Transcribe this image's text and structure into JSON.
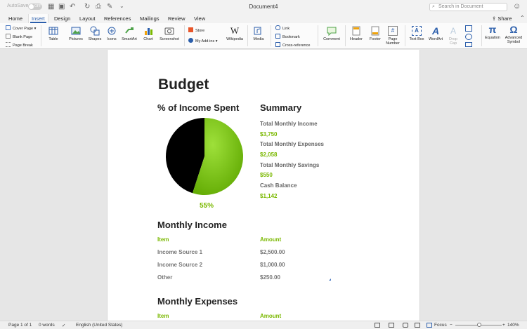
{
  "titlebar": {
    "autosave": "AutoSave",
    "autosave_state": "OFF",
    "document": "Document4",
    "search_placeholder": "Search in Document"
  },
  "tabs": [
    "Home",
    "Insert",
    "Design",
    "Layout",
    "References",
    "Mailings",
    "Review",
    "View"
  ],
  "active_tab": "Insert",
  "share": "Share",
  "ribbon": {
    "pages": [
      "Cover Page",
      "Blank Page",
      "Page Break"
    ],
    "table": "Table",
    "pictures": "Pictures",
    "shapes": "Shapes",
    "icons": "Icons",
    "smartart": "SmartArt",
    "chart": "Chart",
    "screenshot": "Screenshot",
    "store": "Store",
    "addins": "My Add-ins",
    "wikipedia": "Wikipedia",
    "media": "Media",
    "link": "Link",
    "bookmark": "Bookmark",
    "crossref": "Cross-reference",
    "comment": "Comment",
    "header": "Header",
    "footer": "Footer",
    "page_number": [
      "Page",
      "Number"
    ],
    "text_box": "Text Box",
    "wordart": "WordArt",
    "drop_cap": [
      "Drop",
      "Cap"
    ],
    "equation": "Equation",
    "advanced_symbol": [
      "Advanced",
      "Symbol"
    ]
  },
  "doc": {
    "title": "Budget",
    "pie_heading": "% of Income Spent",
    "pie_percent": "55%",
    "pie_fraction": 0.55,
    "summary_heading": "Summary",
    "summary": [
      {
        "label": "Total Monthly Income",
        "value": "$3,750"
      },
      {
        "label": "Total Monthly Expenses",
        "value": "$2,058"
      },
      {
        "label": "Total Monthly Savings",
        "value": "$550"
      },
      {
        "label": "Cash Balance",
        "value": "$1,142"
      }
    ],
    "income_heading": "Monthly Income",
    "col_item": "Item",
    "col_amount": "Amount",
    "income_rows": [
      {
        "item": "Income Source 1",
        "amount": "$2,500.00"
      },
      {
        "item": "Income Source 2",
        "amount": "$1,000.00"
      },
      {
        "item": "Other",
        "amount": "$250.00"
      }
    ],
    "expenses_heading": "Monthly Expenses",
    "exp_col_item": "Item",
    "exp_col_amount": "Amount"
  },
  "status": {
    "page": "Page 1 of 1",
    "words": "0 words",
    "language": "English (United States)",
    "focus": "Focus",
    "zoom": "140%"
  },
  "colors": {
    "accent": "#7ab800",
    "pie_dark": "#000000",
    "pie_green": "#7ac70c",
    "tab_blue": "#2b5eab"
  }
}
